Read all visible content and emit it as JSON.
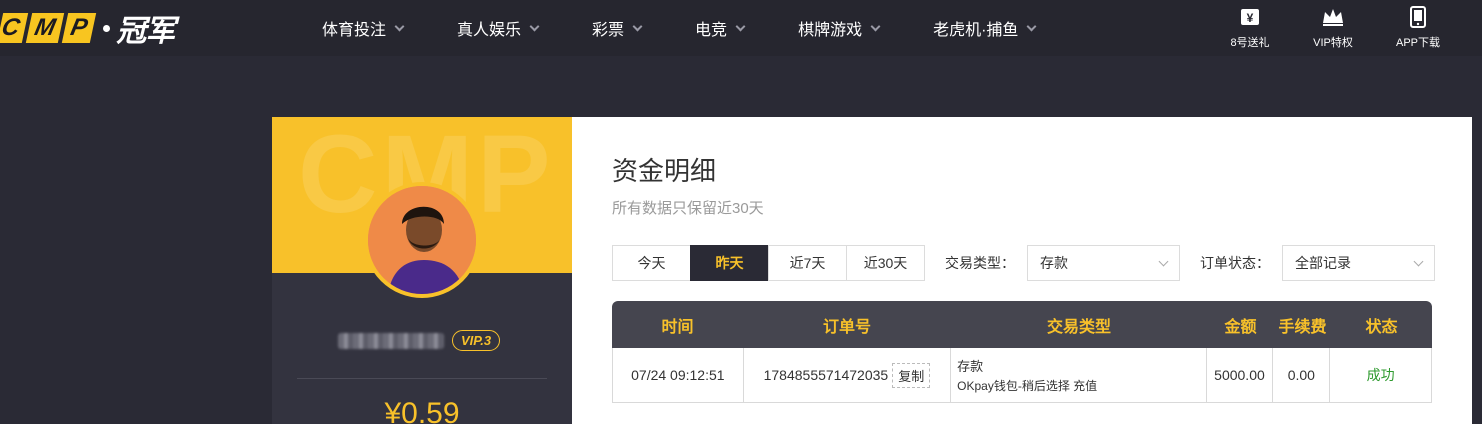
{
  "brand": {
    "letters": [
      "C",
      "M",
      "P"
    ],
    "name": "冠军"
  },
  "nav": {
    "items": [
      {
        "label": "体育投注"
      },
      {
        "label": "真人娱乐"
      },
      {
        "label": "彩票"
      },
      {
        "label": "电竞"
      },
      {
        "label": "棋牌游戏"
      },
      {
        "label": "老虎机·捕鱼"
      }
    ]
  },
  "quick_links": [
    {
      "label": "8号送礼",
      "icon": "gift-icon"
    },
    {
      "label": "VIP特权",
      "icon": "crown-icon"
    },
    {
      "label": "APP下载",
      "icon": "phone-icon"
    }
  ],
  "profile": {
    "banner_text": "CMP",
    "vip_badge": "VIP.3",
    "balance": "¥0.59"
  },
  "panel": {
    "title": "资金明细",
    "subtitle": "所有数据只保留近30天"
  },
  "filters": {
    "date_range": [
      "今天",
      "昨天",
      "近7天",
      "近30天"
    ],
    "date_range_selected_index": 1,
    "type_label": "交易类型：",
    "type_value": "存款",
    "status_label": "订单状态：",
    "status_value": "全部记录"
  },
  "table": {
    "headers": [
      "时间",
      "订单号",
      "交易类型",
      "金额",
      "手续费",
      "状态"
    ],
    "rows": [
      {
        "time": "07/24 09:12:51",
        "order_no": "1784855571472035",
        "copy_label": "复制",
        "type_main": "存款",
        "type_detail": "OKpay钱包-稍后选择 充值",
        "amount": "5000.00",
        "fee": "0.00",
        "status": "成功"
      }
    ]
  },
  "colors": {
    "accent": "#f8c12a",
    "nav_bg": "#26262f",
    "page_bg": "#2a2a35",
    "success": "#2e9a2e"
  }
}
